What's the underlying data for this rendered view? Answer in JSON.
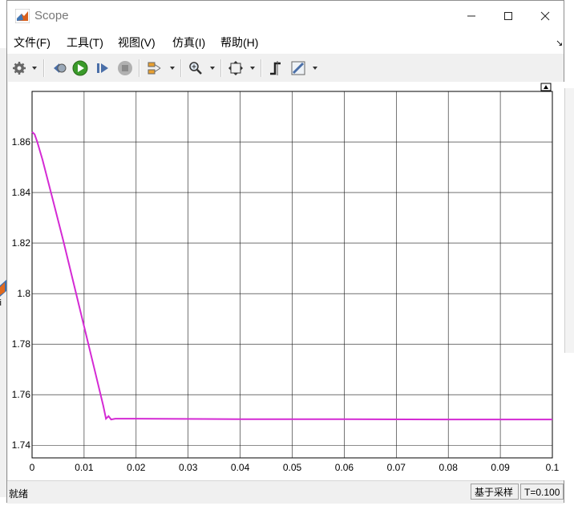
{
  "window": {
    "title": "Scope"
  },
  "menu": [
    {
      "label": "文件(F)"
    },
    {
      "label": "工具(T)"
    },
    {
      "label": "视图(V)"
    },
    {
      "label": "仿真(I)"
    },
    {
      "label": "帮助(H)"
    }
  ],
  "toolbar_icons": [
    "gear-icon",
    "step-back-icon",
    "run-icon",
    "step-forward-icon",
    "stop-icon",
    "signal-selector-icon",
    "zoom-icon",
    "fit-to-view-icon",
    "cursor-measure-icon",
    "bilevel-measure-icon"
  ],
  "background": {
    "partial_label": "ci"
  },
  "chart_data": {
    "type": "line",
    "title": "",
    "xlabel": "",
    "ylabel": "",
    "xlim": [
      0,
      0.1
    ],
    "ylim": [
      1.735,
      1.88
    ],
    "grid": true,
    "x_ticks": [
      "0",
      "0.01",
      "0.02",
      "0.03",
      "0.04",
      "0.05",
      "0.06",
      "0.07",
      "0.08",
      "0.09",
      "0.1"
    ],
    "y_ticks": [
      "1.74",
      "1.76",
      "1.78",
      "1.8",
      "1.82",
      "1.84",
      "1.86"
    ],
    "series": [
      {
        "color": "#d42ad4",
        "x": [
          0,
          0.0005,
          0.001,
          0.002,
          0.004,
          0.006,
          0.008,
          0.01,
          0.012,
          0.0137,
          0.0142,
          0.0147,
          0.0152,
          0.016,
          0.02,
          0.04,
          0.06,
          0.08,
          0.1
        ],
        "y": [
          1.864,
          1.863,
          1.86,
          1.853,
          1.837,
          1.821,
          1.804,
          1.787,
          1.77,
          1.7555,
          1.7505,
          1.7515,
          1.7502,
          1.7505,
          1.7505,
          1.7503,
          1.7503,
          1.7502,
          1.7502
        ]
      }
    ]
  },
  "status": {
    "ready": "就绪",
    "mode": "基于采样",
    "time": "T=0.100"
  }
}
